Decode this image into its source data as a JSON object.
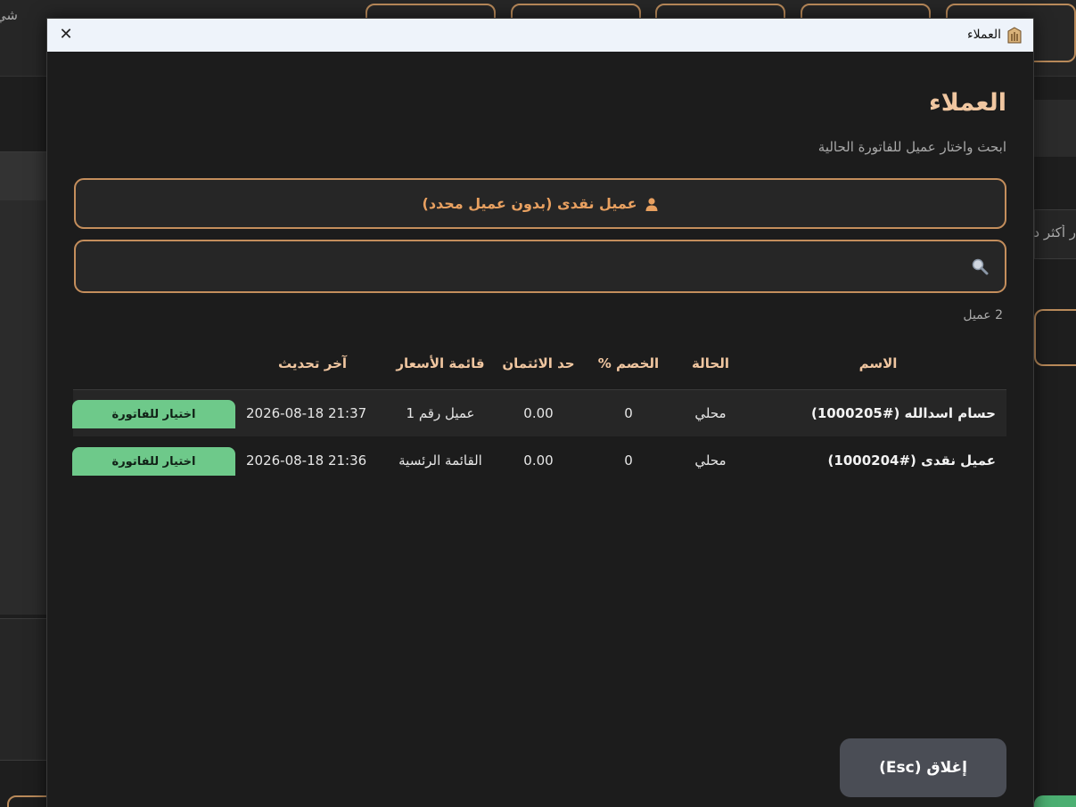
{
  "background": {
    "left_fragment": "شي",
    "right_fragment": "ر أكثر د"
  },
  "window": {
    "title": "العملاء",
    "close_symbol": "✕"
  },
  "page": {
    "title": "العملاء",
    "subtitle": "ابحث واختار عميل للفاتورة الحالية",
    "walkin_label": "عميل نقدى (بدون عميل محدد)",
    "search_value": "",
    "count_label": "2 عميل"
  },
  "table": {
    "headers": {
      "name": "الاسم",
      "status": "الحالة",
      "discount": "الخصم %",
      "credit_limit": "حد الائتمان",
      "price_list": "قائمة الأسعار",
      "updated": "آخر تحديث"
    },
    "rows": [
      {
        "name": "حسام اسدالله (#1000205)",
        "status": "محلي",
        "discount": "0",
        "credit_limit": "0.00",
        "price_list": "عميل رقم 1",
        "updated": "2026-08-18 21:37",
        "action": "اختيار للفاتورة"
      },
      {
        "name": "عميل نقدى (#1000204)",
        "status": "محلي",
        "discount": "0",
        "credit_limit": "0.00",
        "price_list": "القائمة الرئسية",
        "updated": "2026-08-18 21:36",
        "action": "اختيار للفاتورة"
      }
    ]
  },
  "footer": {
    "close_label": "إغلاق (Esc)"
  },
  "colors": {
    "accent": "#c48e5c",
    "title": "#f0c6a0",
    "action_green": "#6ec98a",
    "modal_bg": "#1c1c1c"
  }
}
